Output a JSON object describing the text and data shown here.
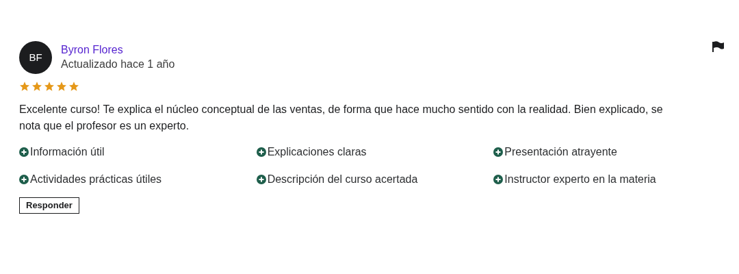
{
  "review": {
    "avatar_initials": "BF",
    "author": "Byron Flores",
    "updated": "Actualizado hace 1 año",
    "stars": 5,
    "text": "Excelente curso! Te explica el núcleo conceptual de las ventas, de forma que hace mucho sentido con la realidad. Bien explicado, se nota que el profesor es un experto.",
    "tags": [
      "Información útil",
      "Explicaciones claras",
      "Presentación atrayente",
      "Actividades prácticas útiles",
      "Descripción del curso acertada",
      "Instructor experto en la materia"
    ],
    "reply_button": "Responder"
  }
}
